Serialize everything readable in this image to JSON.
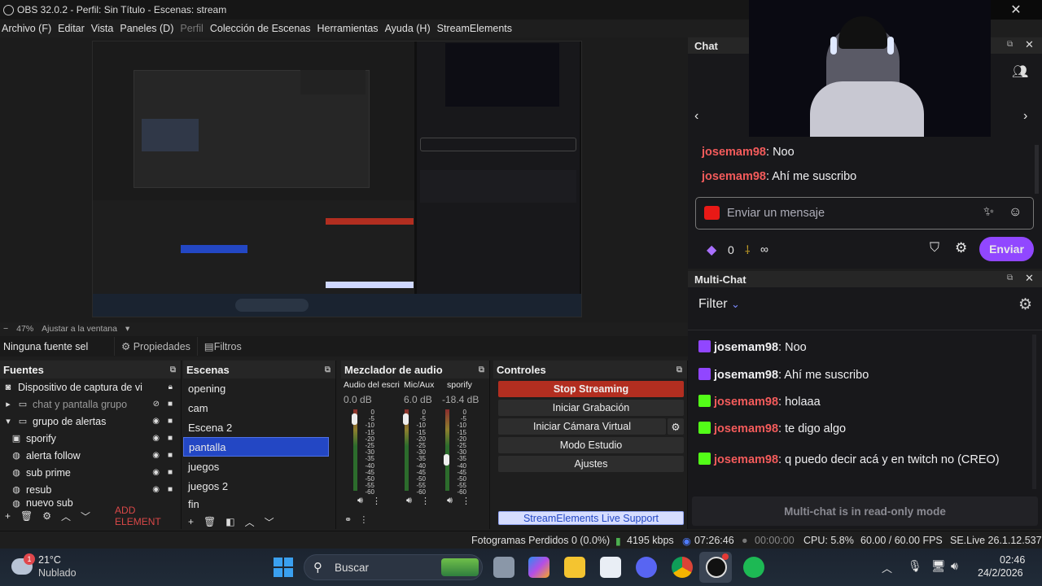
{
  "window": {
    "title": "OBS 32.0.2 - Perfil: Sin Título - Escenas: stream"
  },
  "menu": [
    "Archivo (F)",
    "Editar",
    "Vista",
    "Paneles (D)",
    "Perfil",
    "Colección de Escenas",
    "Herramientas",
    "Ayuda (H)",
    "StreamElements"
  ],
  "zoom": {
    "percent": "47%",
    "fit_label": "Ajustar a la ventana"
  },
  "props": {
    "no_source": "Ninguna fuente sel",
    "properties": "Propiedades",
    "filters": "Filtros"
  },
  "sources": {
    "title": "Fuentes",
    "items": [
      "Dispositivo de captura de vi",
      "chat y pantalla grupo",
      "grupo de alertas",
      "sporify",
      "alerta follow",
      "sub prime",
      "resub",
      "nuevo sub"
    ],
    "add_element": "ADD ELEMENT"
  },
  "scenes": {
    "title": "Escenas",
    "items": [
      "opening",
      "cam",
      "Escena 2",
      "pantalla",
      "juegos",
      "juegos 2",
      "fin"
    ],
    "selected": "pantalla"
  },
  "mixer": {
    "title": "Mezclador de audio",
    "channels": [
      {
        "name": "Audio del escri",
        "db": "0.0 dB",
        "level": 0.05
      },
      {
        "name": "Mic/Aux",
        "db": "6.0 dB",
        "level": 0.05
      },
      {
        "name": "sporify",
        "db": "-18.4 dB",
        "level": 0.55
      }
    ],
    "scale": [
      "0",
      "-5",
      "-10",
      "-15",
      "-20",
      "-25",
      "-30",
      "-35",
      "-40",
      "-45",
      "-50",
      "-55",
      "-60"
    ]
  },
  "controls": {
    "title": "Controles",
    "stop_streaming": "Stop Streaming",
    "start_recording": "Iniciar Grabación",
    "virtual_cam": "Iniciar Cámara Virtual",
    "studio_mode": "Modo Estudio",
    "settings": "Ajustes",
    "support": "StreamElements Live Support"
  },
  "chat": {
    "title": "Chat",
    "messages": [
      {
        "user": "josemam98",
        "text": "Noo"
      },
      {
        "user": "josemam98",
        "text": "Ahí me suscribo"
      }
    ],
    "input_placeholder": "Enviar un mensaje",
    "points": "0",
    "send": "Enviar"
  },
  "multichat": {
    "title": "Multi-Chat",
    "filter": "Filter",
    "messages": [
      {
        "platform": "twitch",
        "user": "josemam98",
        "text": "Noo"
      },
      {
        "platform": "twitch",
        "user": "josemam98",
        "text": "Ahí me suscribo"
      },
      {
        "platform": "kick",
        "user": "josemam98",
        "text": "holaaa"
      },
      {
        "platform": "kick",
        "user": "josemam98",
        "text": "te digo algo"
      },
      {
        "platform": "kick",
        "user": "josemam98",
        "text": "q puedo decir acá y en twitch no (CREO)"
      }
    ],
    "readonly": "Multi-chat is in read-only mode"
  },
  "status": {
    "dropped": "Fotogramas Perdidos 0 (0.0%)",
    "bitrate": "4195 kbps",
    "stream_time": "07:26:46",
    "rec_time": "00:00:00",
    "cpu": "CPU: 5.8%",
    "fps": "60.00 / 60.00 FPS",
    "version": "SE.Live 26.1.12.537"
  },
  "taskbar": {
    "temp": "21°C",
    "weather": "Nublado",
    "weather_badge": "1",
    "search": "Buscar",
    "time": "02:46",
    "date": "24/2/2026"
  },
  "colors": {
    "accent_blue": "#2347c4",
    "stop_red": "#b22e20",
    "twitch_purple": "#9146ff",
    "kick_green": "#53fc18",
    "chat_name_red": "#f35b5b"
  }
}
